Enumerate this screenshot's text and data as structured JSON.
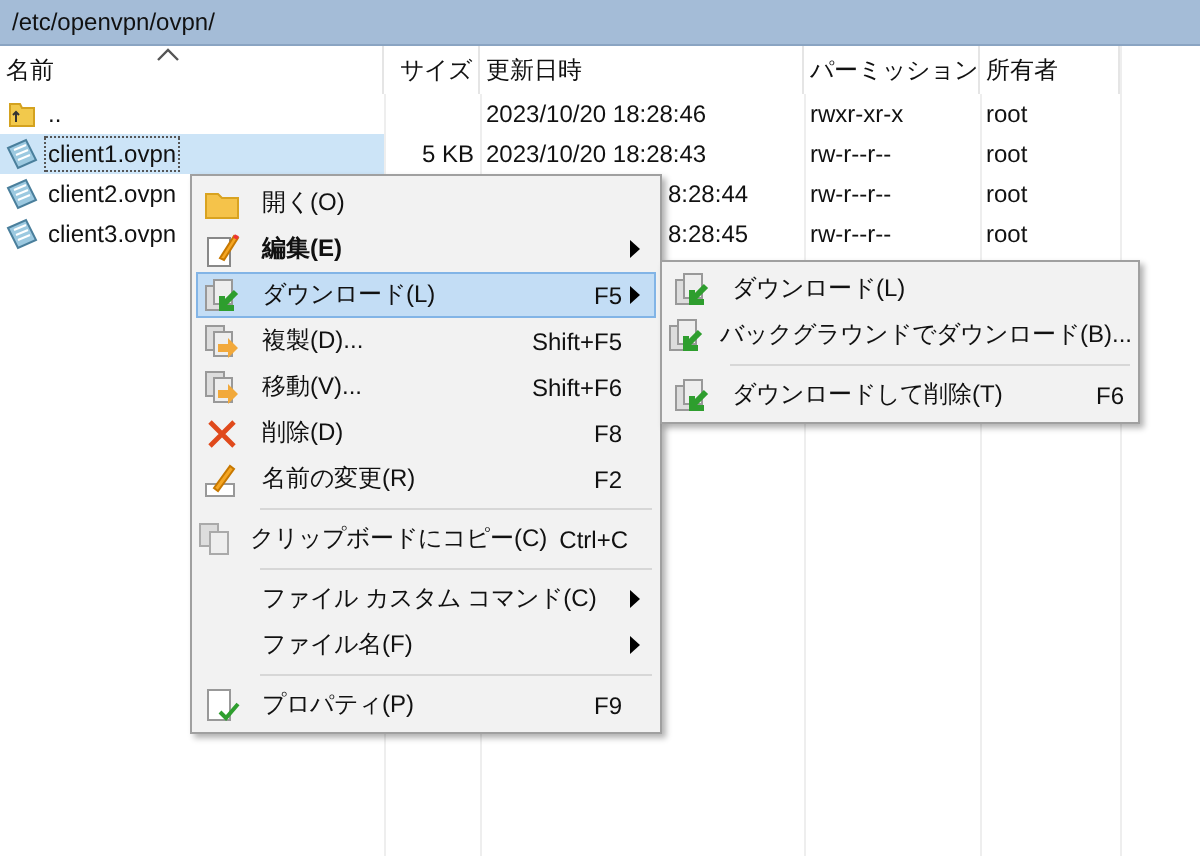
{
  "path_bar": {
    "path": "/etc/openvpn/ovpn/"
  },
  "table": {
    "columns": [
      {
        "label": "名前",
        "sorted": true
      },
      {
        "label": "サイズ",
        "sorted": false
      },
      {
        "label": "更新日時",
        "sorted": false
      },
      {
        "label": "パーミッション",
        "sorted": false
      },
      {
        "label": "所有者",
        "sorted": false
      }
    ],
    "rows": [
      {
        "kind": "parent",
        "name": "..",
        "modified": "2023/10/20 18:28:46",
        "permissions": "rwxr-xr-x",
        "owner": "root",
        "selected": false
      },
      {
        "kind": "file",
        "name": "client1.ovpn",
        "size": "5 KB",
        "modified": "2023/10/20 18:28:43",
        "permissions": "rw-r--r--",
        "owner": "root",
        "selected": true
      },
      {
        "kind": "file",
        "name": "client2.ovpn",
        "modified": "8:28:44",
        "permissions": "rw-r--r--",
        "owner": "root",
        "selected": false
      },
      {
        "kind": "file",
        "name": "client3.ovpn",
        "modified": "8:28:45",
        "permissions": "rw-r--r--",
        "owner": "root",
        "selected": false
      }
    ]
  },
  "context_menu": {
    "items": [
      {
        "kind": "item",
        "label": "開く(O)",
        "bold": false,
        "submenu": false,
        "selected": false
      },
      {
        "kind": "item",
        "label": "編集(E)",
        "bold": true,
        "submenu": true,
        "selected": false
      },
      {
        "kind": "item",
        "label": "ダウンロード(L)",
        "shortcut": "F5",
        "bold": false,
        "submenu": true,
        "selected": true
      },
      {
        "kind": "item",
        "label": "複製(D)...",
        "shortcut": "Shift+F5",
        "bold": false,
        "submenu": false,
        "selected": false
      },
      {
        "kind": "item",
        "label": "移動(V)...",
        "shortcut": "Shift+F6",
        "bold": false,
        "submenu": false,
        "selected": false
      },
      {
        "kind": "item",
        "label": "削除(D)",
        "shortcut": "F8",
        "bold": false,
        "submenu": false,
        "selected": false
      },
      {
        "kind": "item",
        "label": "名前の変更(R)",
        "shortcut": "F2",
        "bold": false,
        "submenu": false,
        "selected": false
      },
      {
        "kind": "separator"
      },
      {
        "kind": "item",
        "label": "クリップボードにコピー(C)",
        "shortcut": "Ctrl+C",
        "bold": false,
        "submenu": false,
        "selected": false
      },
      {
        "kind": "separator"
      },
      {
        "kind": "item",
        "label": "ファイル カスタム コマンド(C)",
        "bold": false,
        "submenu": true,
        "selected": false
      },
      {
        "kind": "item",
        "label": "ファイル名(F)",
        "bold": false,
        "submenu": true,
        "selected": false
      },
      {
        "kind": "separator"
      },
      {
        "kind": "item",
        "label": "プロパティ(P)",
        "shortcut": "F9",
        "bold": false,
        "submenu": false,
        "selected": false
      }
    ]
  },
  "submenu": {
    "items": [
      {
        "kind": "item",
        "label": "ダウンロード(L)"
      },
      {
        "kind": "item",
        "label": "バックグラウンドでダウンロード(B)..."
      },
      {
        "kind": "separator"
      },
      {
        "kind": "item",
        "label": "ダウンロードして削除(T)",
        "shortcut": "F6"
      }
    ]
  }
}
